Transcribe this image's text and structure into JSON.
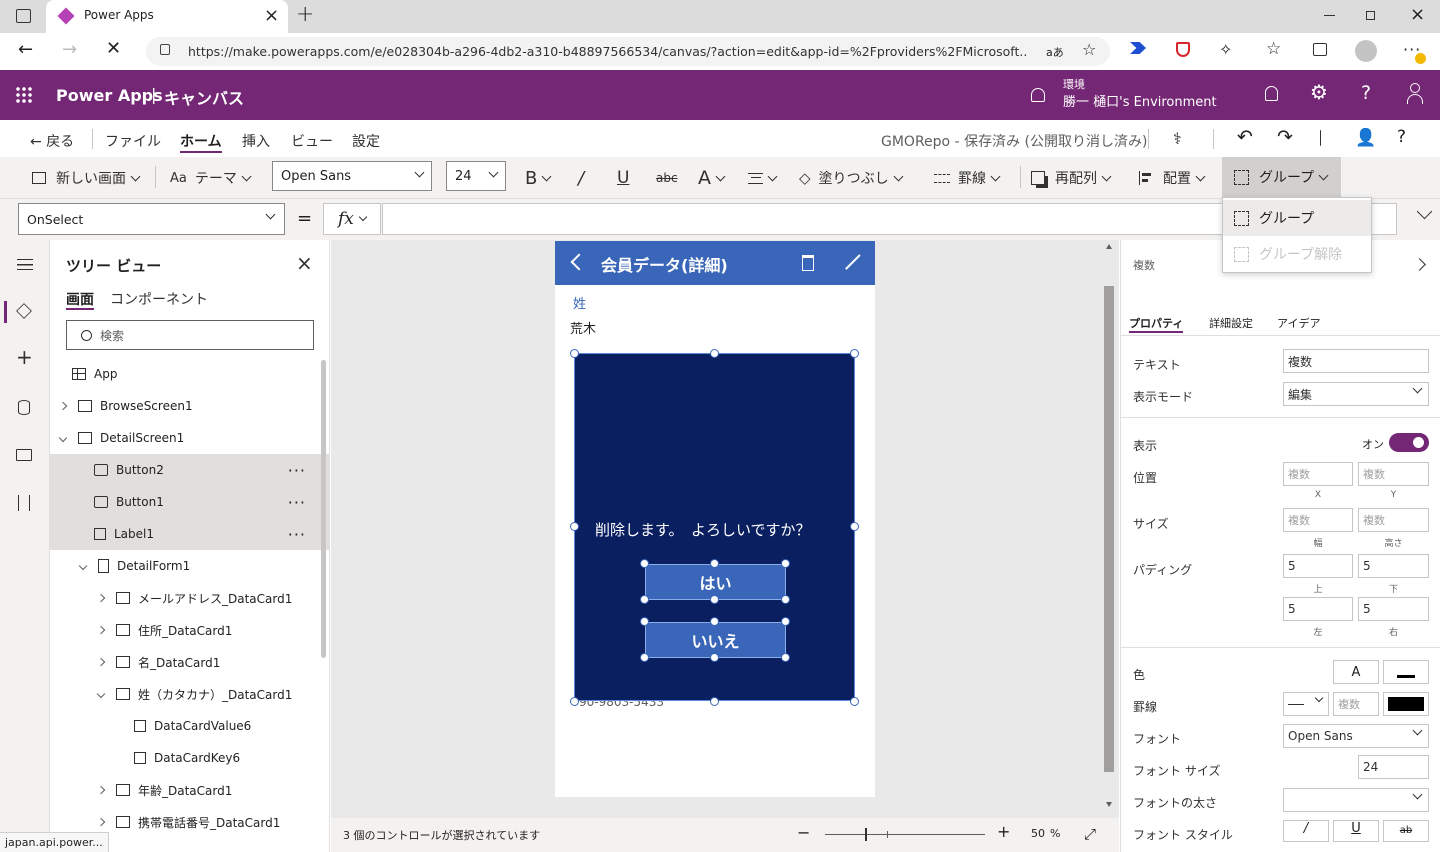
{
  "browser": {
    "tab_title": "Power Apps",
    "url": "https://make.powerapps.com/e/e028304b-a296-4db2-a310-b48897566534/canvas/?action=edit&app-id=%2Fproviders%2FMicrosoft....",
    "reader_label": "aあ",
    "status_url": "japan.api.power..."
  },
  "header": {
    "app_name": "Power Apps",
    "divider": "|",
    "section": "キャンバス",
    "env_label": "環境",
    "env_name": "勝一 樋口's Environment"
  },
  "menu": {
    "back": "戻る",
    "items": [
      "ファイル",
      "ホーム",
      "挿入",
      "ビュー",
      "設定"
    ],
    "save_status": "GMORepo - 保存済み (公開取り消し済み)"
  },
  "ribbon": {
    "new_screen": "新しい画面",
    "theme": "テーマ",
    "font": "Open Sans",
    "font_size": "24",
    "fill": "塗りつぶし",
    "border": "罫線",
    "reorder": "再配列",
    "align": "配置",
    "group": "グループ"
  },
  "formula": {
    "property": "OnSelect",
    "equals": "=",
    "fx": "fx",
    "value": ""
  },
  "group_menu": {
    "group": "グループ",
    "ungroup": "グループ解除"
  },
  "tree": {
    "title": "ツリー ビュー",
    "tabs": [
      "画面",
      "コンポーネント"
    ],
    "search_placeholder": "検索",
    "rows": [
      {
        "label": "App"
      },
      {
        "label": "BrowseScreen1"
      },
      {
        "label": "DetailScreen1"
      },
      {
        "label": "Button2"
      },
      {
        "label": "Button1"
      },
      {
        "label": "Label1"
      },
      {
        "label": "DetailForm1"
      },
      {
        "label": "メールアドレス_DataCard1"
      },
      {
        "label": "住所_DataCard1"
      },
      {
        "label": "名_DataCard1"
      },
      {
        "label": "姓（カタカナ）_DataCard1"
      },
      {
        "label": "DataCardValue6"
      },
      {
        "label": "DataCardKey6"
      },
      {
        "label": "年齢_DataCard1"
      },
      {
        "label": "携帯電話番号_DataCard1"
      }
    ],
    "more": "···"
  },
  "canvas": {
    "screen_title": "会員データ(詳細)",
    "field_label": "姓",
    "field_value": "荒木",
    "dialog_text": "削除します。　よろしいですか？",
    "yes_button": "はい",
    "no_button": "いいえ",
    "phone_fragment": "90-9803-5433"
  },
  "status": {
    "selection": "3 個のコントロールが選択されています",
    "zoom_minus": "−",
    "zoom_plus": "+",
    "zoom_value": "50",
    "zoom_unit": "%",
    "zoom_level": 50
  },
  "props": {
    "selection": "複数",
    "tabs": [
      "プロパティ",
      "詳細設定",
      "アイデア"
    ],
    "text_label": "テキスト",
    "text_value": "複数",
    "display_mode_label": "表示モード",
    "display_mode_value": "編集",
    "visible_label": "表示",
    "visible_value": "オン",
    "position_label": "位置",
    "size_label": "サイズ",
    "padding_label": "パディング",
    "multi": "複数",
    "x": "X",
    "y": "Y",
    "width": "幅",
    "height": "高さ",
    "pad_top": "5",
    "pad_bottom": "5",
    "pad_left": "5",
    "pad_right": "5",
    "top": "上",
    "bottom": "下",
    "left": "左",
    "right": "右",
    "color_label": "色",
    "color_a": "A",
    "border_label": "罫線",
    "font_label": "フォント",
    "font_value": "Open Sans",
    "font_size_label": "フォント サイズ",
    "font_size_value": "24",
    "font_weight_label": "フォントの太さ",
    "font_style_label": "フォント スタイル",
    "italic": "/",
    "underline": "U",
    "strike": "ab"
  },
  "colors": {
    "brand": "#742774",
    "screen_header": "#3966b8",
    "dialog_bg": "#0a1f60",
    "toggle_on": "#742774"
  }
}
